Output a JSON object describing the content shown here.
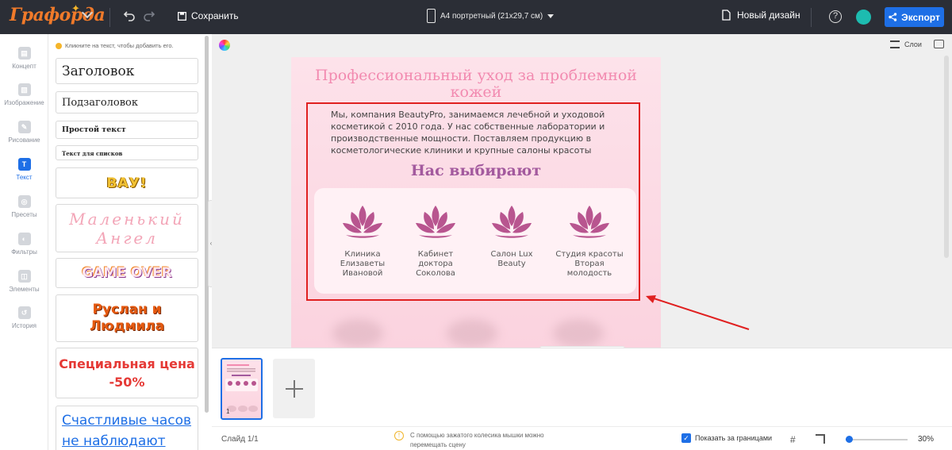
{
  "app": {
    "logo_text": "Графорда",
    "save_label": "Сохранить",
    "format_label": "A4 портретный (21x29,7 см)",
    "new_design_label": "Новый дизайн",
    "export_label": "Экспорт",
    "help_label": "?"
  },
  "rail": {
    "items": [
      {
        "label": "Концепт",
        "icon": "concept-icon"
      },
      {
        "label": "Изображение",
        "icon": "image-icon"
      },
      {
        "label": "Рисование",
        "icon": "brush-icon"
      },
      {
        "label": "Текст",
        "icon": "text-icon",
        "active": true
      },
      {
        "label": "Пресеты",
        "icon": "presets-icon"
      },
      {
        "label": "Фильтры",
        "icon": "filters-icon"
      },
      {
        "label": "Элементы",
        "icon": "elements-icon"
      },
      {
        "label": "История",
        "icon": "history-icon"
      }
    ]
  },
  "panel": {
    "hint": "Кликните на текст, чтобы добавить его.",
    "styles": {
      "heading": "Заголовок",
      "subheading": "Подзаголовок",
      "plain": "Простой текст",
      "list": "Текст для списков",
      "vau": "ВАУ!",
      "angel": "Маленький Ангел",
      "game_over": "GAME OVER",
      "ruslan": "Руслан и Людмила",
      "special": "Специальная цена -50%",
      "happy": "Счастливые часов не наблюдают"
    }
  },
  "canvas": {
    "layers_label": "Слои",
    "title": "Профессиональный уход за проблемной кожей",
    "paragraph": "Мы, компания BeautyPro, занимаемся лечебной и уходовой косметикой с 2010 года. У нас собственные лаборатории и производственные мощности. Поставляем продукцию в косметологические клиники и крупные салоны красоты",
    "subtitle": "Нас выбирают",
    "clients": [
      "Клиника Елизаветы Ивановой",
      "Кабинет доктора Соколова",
      "Салон Lux Beauty",
      "Студия красоты Вторая молодость"
    ],
    "accent_color": "#f28ab0",
    "highlight_color": "#e02020"
  },
  "slides": {
    "thumb_number": "1",
    "counter": "Слайд 1/1"
  },
  "bottom": {
    "tip": "С помощью зажатого колесика мышки можно перемещать сцену",
    "show_bounds_label": "Показать за границами",
    "show_bounds_checked": true,
    "zoom_label": "30%",
    "zoom_percent": 30
  }
}
